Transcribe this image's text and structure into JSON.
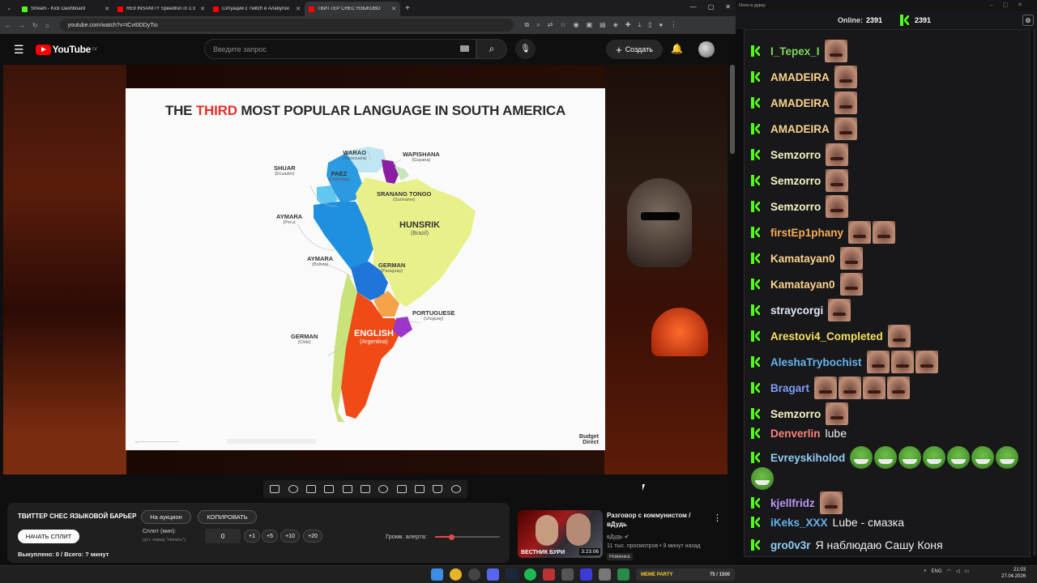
{
  "browser": {
    "tabs": [
      {
        "title": "Stream - Kick Dashboard",
        "color": "#53fc18"
      },
      {
        "title": "RE9 INSANITY Speedrun in 1:3",
        "color": "#ff0000"
      },
      {
        "title": "Ситуация с Twitch и Алабугой",
        "color": "#ff0000"
      },
      {
        "title": "ТВИТТЕР СНЕС ЯЗЫКОВО",
        "color": "#ff0000"
      }
    ],
    "new_tab": "+",
    "url": "youtube.com/watch?v=tCvt0DDyTio"
  },
  "youtube": {
    "logo_text": "YouTube",
    "logo_country": "LV",
    "search_placeholder": "Введите запрос",
    "create_label": "Создать"
  },
  "slide": {
    "title_pre": "THE",
    "title_highlight": "THIRD",
    "title_post": "MOST POPULAR LANGUAGE IN SOUTH AMERICA",
    "labels": [
      {
        "lang": "WARAO",
        "country": "(Venezuela)"
      },
      {
        "lang": "WAPISHANA",
        "country": "(Guyana)"
      },
      {
        "lang": "SHUAR",
        "country": "(Ecuador)"
      },
      {
        "lang": "PAEZ",
        "country": "(Colombia)"
      },
      {
        "lang": "SRANANG TONGO",
        "country": "(Suriname)"
      },
      {
        "lang": "AYMARA",
        "country": "(Peru)"
      },
      {
        "lang": "HUNSRIK",
        "country": "(Brazil)"
      },
      {
        "lang": "AYMARA",
        "country": "(Bolivia)"
      },
      {
        "lang": "GERMAN",
        "country": "(Paraguay)"
      },
      {
        "lang": "PORTUGUESE",
        "country": "(Uruguay)"
      },
      {
        "lang": "GERMAN",
        "country": "(Chile)"
      },
      {
        "lang": "ENGLISH",
        "country": "(Argentina)"
      }
    ],
    "brand_line1": "Budget",
    "brand_line2": "Direct"
  },
  "auction": {
    "title": "ТВИТТЕР СНЕС ЯЗЫКОВОЙ БАРЬЕР",
    "on_auction": "На аукцион",
    "copy": "КОПИРОВАТЬ",
    "start_split": "НАЧАТЬ СПЛИТ",
    "split_label": "Сплит (мин):",
    "split_hint": "(уст. перед \"Начать\")",
    "split_value": "0",
    "steps": [
      "+1",
      "+5",
      "+10",
      "+20"
    ],
    "volume_label": "Громк. алерта:",
    "volume_level": 0.25,
    "bought": "Выкуплено: 0 / Всего: ? минут"
  },
  "related": {
    "title": "Разговор с коммунистом / вДудь",
    "channel": "вДудь",
    "meta": "11 тыс. просмотров • 9 минут назад",
    "badge": "Новинка",
    "thumb_caption": "ВЕСТНИК БУРИ",
    "duration": "3:23:06"
  },
  "chat": {
    "window_title": "Окно в дурку",
    "online_label": "Online:",
    "online_count": "2391",
    "kick_count": "2391",
    "messages": [
      {
        "user": "I_Tepex_I",
        "color": "#7ed957",
        "emotes": 1,
        "text": ""
      },
      {
        "user": "AMADEIRA",
        "color": "#fbd38d",
        "emotes": 1,
        "text": ""
      },
      {
        "user": "AMADEIRA",
        "color": "#fbd38d",
        "emotes": 1,
        "text": ""
      },
      {
        "user": "AMADEIRA",
        "color": "#fbd38d",
        "emotes": 1,
        "text": ""
      },
      {
        "user": "Semzorro",
        "color": "#f5f5c5",
        "emotes": 1,
        "text": ""
      },
      {
        "user": "Semzorro",
        "color": "#f5f5c5",
        "emotes": 1,
        "text": ""
      },
      {
        "user": "Semzorro",
        "color": "#f5f5c5",
        "emotes": 1,
        "text": ""
      },
      {
        "user": "firstEp1phany",
        "color": "#f6ad55",
        "emotes": 2,
        "text": ""
      },
      {
        "user": "Kamatayan0",
        "color": "#fbd38d",
        "emotes": 1,
        "text": ""
      },
      {
        "user": "Kamatayan0",
        "color": "#fbd38d",
        "emotes": 1,
        "text": ""
      },
      {
        "user": "straycorgi",
        "color": "#e2e8f0",
        "emotes": 1,
        "text": ""
      },
      {
        "user": "Arestovi4_Completed",
        "color": "#f6e05e",
        "emotes": 1,
        "text": ""
      },
      {
        "user": "AleshaTrybochist",
        "color": "#63b3ed",
        "emotes": 3,
        "text": ""
      },
      {
        "user": "Bragart",
        "color": "#7f9cf5",
        "emotes": 4,
        "text": ""
      },
      {
        "user": "Semzorro",
        "color": "#f5f5c5",
        "emotes": 1,
        "text": ""
      },
      {
        "user": "Denverlin",
        "color": "#fc8181",
        "emotes": 0,
        "text": "lube"
      },
      {
        "user": "Evreyskiholod",
        "color": "#90cdf4",
        "emotes": 0,
        "pepe": 8,
        "text": ""
      },
      {
        "user": "kjellfridz",
        "color": "#b794f4",
        "emotes": 1,
        "text": ""
      },
      {
        "user": "iKeks_XXX",
        "color": "#63b3ed",
        "emotes": 0,
        "text": "Lube - смазка"
      },
      {
        "user": "gro0v3r",
        "color": "#90cdf4",
        "emotes": 0,
        "text": "Я наблюдаю Сашу Коня"
      }
    ]
  },
  "taskbar": {
    "meme_label": "MEME PARTY",
    "meme_count": "75 / 1500",
    "lang": "ENG",
    "time": "21:03",
    "date": "27.04.2026"
  }
}
